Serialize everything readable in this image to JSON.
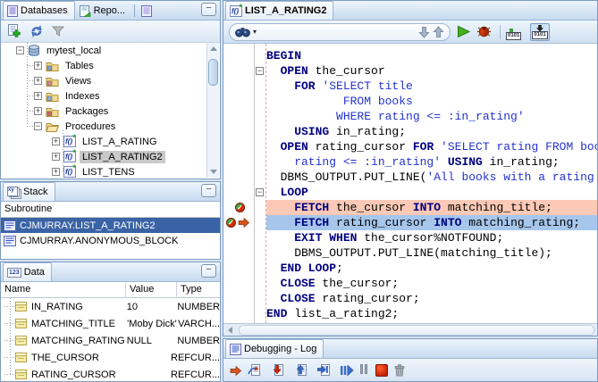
{
  "glyphs": {
    "expand_plus": "+",
    "expand_minus": "−",
    "minimize": "–",
    "search_caret": "▾",
    "proc_fn": "f()",
    "proc_star": "*",
    "binary": "0101",
    "data_tab_badge": "123",
    "stack_tab_badge": "xy",
    "check": "✓"
  },
  "colors": {
    "keyword": "#000080",
    "string": "#2333cc",
    "plain": "#000000",
    "breakpoint_line": "#fbc9b6",
    "current_line": "#a6c6ec",
    "stack_selected_bg": "#3a63a5",
    "tree_selected_bg": "#c9c9c9"
  },
  "databases_panel": {
    "tabs": [
      {
        "label": "Databases",
        "active": true
      },
      {
        "label": "Repo...",
        "active": false
      },
      {
        "label": "",
        "active": false
      }
    ],
    "toolbar": [
      "add-database",
      "refresh",
      "filter"
    ],
    "tree": [
      {
        "label": "mytest_local",
        "level": 0,
        "icon": "database",
        "expander": "minus",
        "selected": false
      },
      {
        "label": "Tables",
        "level": 1,
        "icon": "folder-tables",
        "expander": "plus",
        "selected": false
      },
      {
        "label": "Views",
        "level": 1,
        "icon": "folder-views",
        "expander": "plus",
        "selected": false
      },
      {
        "label": "Indexes",
        "level": 1,
        "icon": "folder-indexes",
        "expander": "plus",
        "selected": false
      },
      {
        "label": "Packages",
        "level": 1,
        "icon": "folder-packages",
        "expander": "plus",
        "selected": false
      },
      {
        "label": "Procedures",
        "level": 1,
        "icon": "folder-open",
        "expander": "minus",
        "selected": false
      },
      {
        "label": "LIST_A_RATING",
        "level": 2,
        "icon": "procedure",
        "expander": "plus",
        "selected": false
      },
      {
        "label": "LIST_A_RATING2",
        "level": 2,
        "icon": "procedure",
        "expander": "plus",
        "selected": true
      },
      {
        "label": "LIST_TENS",
        "level": 2,
        "icon": "procedure",
        "expander": "plus",
        "selected": false
      }
    ]
  },
  "stack_panel": {
    "title": "Stack",
    "column_header": "Subroutine",
    "rows": [
      {
        "label": "CJMURRAY.LIST_A_RATING2",
        "selected": true
      },
      {
        "label": "CJMURRAY.ANONYMOUS_BLOCK",
        "selected": false
      }
    ]
  },
  "data_panel": {
    "title": "Data",
    "columns": [
      "Name",
      "Value",
      "Type"
    ],
    "rows": [
      {
        "name": "IN_RATING",
        "value": "10",
        "type": "NUMBER"
      },
      {
        "name": "MATCHING_TITLE",
        "value": "'Moby Dick'",
        "type": "VARCH..."
      },
      {
        "name": "MATCHING_RATING",
        "value": "NULL",
        "type": "NUMBER"
      },
      {
        "name": "THE_CURSOR",
        "value": "",
        "type": "REFCUR..."
      },
      {
        "name": "RATING_CURSOR",
        "value": "",
        "type": "REFCUR..."
      }
    ]
  },
  "editor": {
    "tab_label": "LIST_A_RATING2",
    "toolbar": [
      "search",
      "find-next",
      "find-previous",
      "run",
      "debug",
      "compile",
      "compile-for-debug"
    ],
    "code_lines": [
      {
        "tokens": [
          [
            "k",
            "BEGIN"
          ]
        ]
      },
      {
        "fold": "minus",
        "tokens": [
          [
            "k",
            "  OPEN"
          ],
          [
            "p",
            " the_cursor"
          ]
        ]
      },
      {
        "tokens": [
          [
            "k",
            "    FOR"
          ],
          [
            "s",
            " 'SELECT title"
          ]
        ]
      },
      {
        "tokens": [
          [
            "s",
            "           FROM books"
          ]
        ]
      },
      {
        "tokens": [
          [
            "s",
            "          WHERE rating <= :in_rating'"
          ]
        ]
      },
      {
        "tokens": [
          [
            "k",
            "    USING"
          ],
          [
            "p",
            " in_rating;"
          ]
        ]
      },
      {
        "tokens": [
          [
            "k",
            "  OPEN"
          ],
          [
            "p",
            " rating_cursor "
          ],
          [
            "k",
            "FOR"
          ],
          [
            "s",
            " 'SELECT rating FROM books WH"
          ]
        ]
      },
      {
        "tokens": [
          [
            "s",
            "    rating <= :in_rating'"
          ],
          [
            "k",
            " USING"
          ],
          [
            "p",
            " in_rating;"
          ]
        ]
      },
      {
        "tokens": [
          [
            "p",
            "  DBMS_OUTPUT.PUT_LINE("
          ],
          [
            "s",
            "'All books with a rating of '"
          ]
        ]
      },
      {
        "fold": "minus",
        "tokens": [
          [
            "k",
            "  LOOP"
          ]
        ]
      },
      {
        "mark": "breakpoint",
        "hl": "bp",
        "tokens": [
          [
            "k",
            "    FETCH"
          ],
          [
            "p",
            " the_cursor "
          ],
          [
            "k",
            "INTO"
          ],
          [
            "p",
            " matching_title;"
          ]
        ]
      },
      {
        "mark": "breakpoint-current",
        "hl": "cur",
        "tokens": [
          [
            "k",
            "    FETCH"
          ],
          [
            "p",
            " rating_cursor "
          ],
          [
            "k",
            "INTO"
          ],
          [
            "p",
            " matching_rating;"
          ]
        ]
      },
      {
        "tokens": [
          [
            "k",
            "    EXIT WHEN"
          ],
          [
            "p",
            " the_cursor%NOTFOUND;"
          ]
        ]
      },
      {
        "tokens": [
          [
            "p",
            "    DBMS_OUTPUT.PUT_LINE(matching_title);"
          ]
        ]
      },
      {
        "tokens": [
          [
            "k",
            "  END LOOP"
          ],
          [
            "p",
            ";"
          ]
        ]
      },
      {
        "tokens": [
          [
            "k",
            "  CLOSE"
          ],
          [
            "p",
            " the_cursor;"
          ]
        ]
      },
      {
        "tokens": [
          [
            "k",
            "  CLOSE"
          ],
          [
            "p",
            " rating_cursor;"
          ]
        ]
      },
      {
        "tokens": [
          [
            "k",
            "END"
          ],
          [
            "p",
            " list_a_rating2;"
          ]
        ]
      }
    ]
  },
  "log_panel": {
    "title": "Debugging - Log",
    "toolbar": [
      "find-execution-point",
      "step-over",
      "step-into",
      "step-out",
      "step-to-end-of-method",
      "resume",
      "pause",
      "terminate",
      "clear-log"
    ]
  }
}
